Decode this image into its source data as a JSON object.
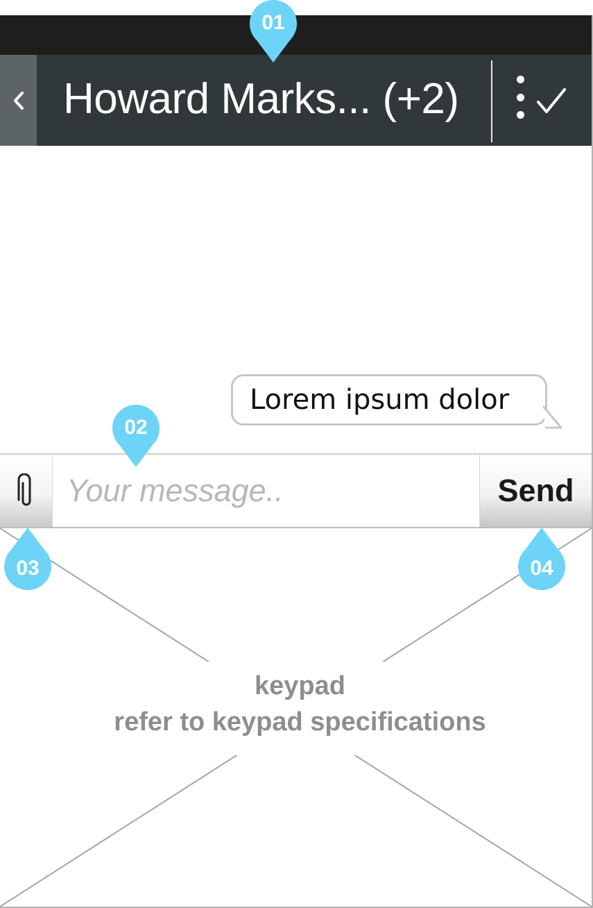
{
  "header": {
    "title": "Howard Marks... (+2)",
    "back_icon": "chevron-left-icon",
    "menu_icon": "vertical-dots-icon",
    "done_icon": "checkmark-icon"
  },
  "chat": {
    "messages": [
      {
        "text": "Lorem ipsum dolor"
      }
    ]
  },
  "composer": {
    "placeholder": "Your message..",
    "attach_icon": "paperclip-icon",
    "send_label": "Send"
  },
  "keypad": {
    "title": "keypad",
    "subtitle": "refer to keypad specifications"
  },
  "callouts": {
    "c01": "01",
    "c02": "02",
    "c03": "03",
    "c04": "04"
  },
  "colors": {
    "header_bg": "#31383a",
    "status_bar_bg": "#1e1f1d",
    "back_button_bg": "#5d6466",
    "callout_fill": "#6dd4f8",
    "keypad_text": "#8e8e8e"
  }
}
